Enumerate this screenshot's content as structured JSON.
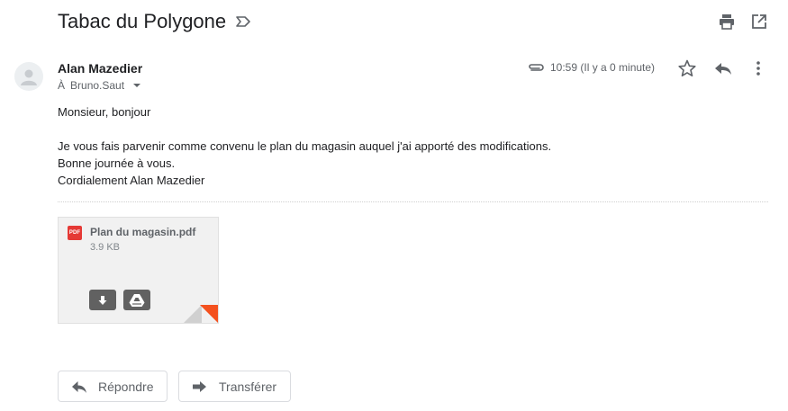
{
  "email": {
    "subject": "Tabac du Polygone",
    "sender_name": "Alan Mazedier",
    "recipient_prefix": "À",
    "recipient": "Bruno.Saut",
    "timestamp": "10:59 (Il y a 0 minute)",
    "body_lines": [
      "Monsieur, bonjour",
      "",
      "Je vous fais parvenir comme convenu le plan du magasin auquel j'ai apporté des modifications.",
      "Bonne journée à vous.",
      "Cordialement Alan Mazedier"
    ]
  },
  "attachment": {
    "type_badge": "PDF",
    "filename": "Plan du magasin.pdf",
    "size": "3.9 KB"
  },
  "actions": {
    "reply_label": "Répondre",
    "forward_label": "Transférer"
  },
  "icons": {
    "label": "label-outline-icon",
    "print": "print-icon",
    "popout": "open-in-new-window-icon",
    "attachment": "paperclip-icon",
    "star": "star-outline-icon",
    "reply": "reply-arrow-icon",
    "more": "more-vertical-icon",
    "download": "download-icon",
    "drive": "google-drive-icon"
  },
  "colors": {
    "pdf_badge": "#e53935",
    "attachment_corner": "#f4511e",
    "text_primary": "#202124",
    "text_secondary": "#5f6368"
  }
}
